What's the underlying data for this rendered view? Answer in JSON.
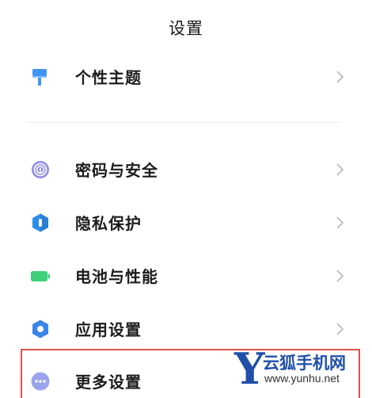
{
  "header": {
    "title": "设置"
  },
  "items": [
    {
      "label": "个性主题",
      "icon": "paint-roller-icon",
      "color": "#3f95f5"
    },
    {
      "label": "密码与安全",
      "icon": "fingerprint-icon",
      "color": "#8f8ee8"
    },
    {
      "label": "隐私保护",
      "icon": "privacy-shield-icon",
      "color": "#2f8fe8"
    },
    {
      "label": "电池与性能",
      "icon": "battery-icon",
      "color": "#3ed07a"
    },
    {
      "label": "应用设置",
      "icon": "gear-icon",
      "color": "#3a86e6"
    },
    {
      "label": "更多设置",
      "icon": "more-dots-icon",
      "color": "#9aa3ee"
    }
  ],
  "watermark": {
    "logo_letter": "Y",
    "name": "云狐手机网",
    "url": "www.yunhu.net",
    "color": "#1f4fa8"
  },
  "highlight_color": "#d9534f"
}
